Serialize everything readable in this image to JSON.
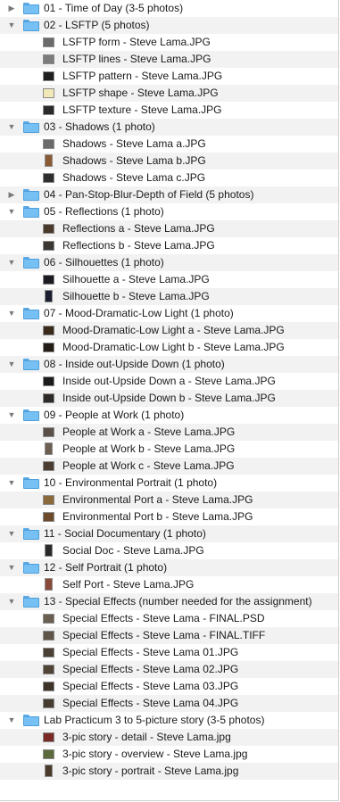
{
  "rows": [
    {
      "type": "folder",
      "expanded": false,
      "name": "01 - Time of Day (3-5 photos)"
    },
    {
      "type": "folder",
      "expanded": true,
      "name": "02 - LSFTP (5 photos)"
    },
    {
      "type": "file",
      "name": "LSFTP form - Steve Lama.JPG",
      "thumb": {
        "color": "#6a6a6a",
        "orientation": "landscape"
      }
    },
    {
      "type": "file",
      "name": "LSFTP lines - Steve Lama.JPG",
      "thumb": {
        "color": "#7c7c7c",
        "orientation": "landscape"
      }
    },
    {
      "type": "file",
      "name": "LSFTP pattern - Steve Lama.JPG",
      "thumb": {
        "color": "#1e1e1e",
        "orientation": "landscape"
      }
    },
    {
      "type": "file",
      "name": "LSFTP shape - Steve Lama.JPG",
      "thumb": {
        "color": "#f1e8b8",
        "orientation": "landscape"
      }
    },
    {
      "type": "file",
      "name": "LSFTP texture - Steve Lama.JPG",
      "thumb": {
        "color": "#2a2a2a",
        "orientation": "landscape"
      }
    },
    {
      "type": "folder",
      "expanded": true,
      "name": "03 - Shadows (1 photo)"
    },
    {
      "type": "file",
      "name": "Shadows - Steve Lama a.JPG",
      "thumb": {
        "color": "#6b6b6b",
        "orientation": "landscape"
      }
    },
    {
      "type": "file",
      "name": "Shadows - Steve Lama b.JPG",
      "thumb": {
        "color": "#8a5a34",
        "orientation": "portrait"
      }
    },
    {
      "type": "file",
      "name": "Shadows - Steve Lama c.JPG",
      "thumb": {
        "color": "#2e2e2e",
        "orientation": "landscape"
      }
    },
    {
      "type": "folder",
      "expanded": false,
      "name": "04 - Pan-Stop-Blur-Depth of Field (5 photos)"
    },
    {
      "type": "folder",
      "expanded": true,
      "name": "05 - Reflections (1 photo)"
    },
    {
      "type": "file",
      "name": "Reflections a - Steve Lama.JPG",
      "thumb": {
        "color": "#4a3a2c",
        "orientation": "landscape"
      }
    },
    {
      "type": "file",
      "name": "Reflections b - Steve Lama.JPG",
      "thumb": {
        "color": "#3a3632",
        "orientation": "landscape"
      }
    },
    {
      "type": "folder",
      "expanded": true,
      "name": "06 - Silhouettes (1 photo)"
    },
    {
      "type": "file",
      "name": "Silhouette a - Steve Lama.JPG",
      "thumb": {
        "color": "#1c1c22",
        "orientation": "landscape"
      }
    },
    {
      "type": "file",
      "name": "Silhouette b - Steve Lama.JPG",
      "thumb": {
        "color": "#1a1e30",
        "orientation": "portrait"
      }
    },
    {
      "type": "folder",
      "expanded": true,
      "name": "07 - Mood-Dramatic-Low Light (1 photo)"
    },
    {
      "type": "file",
      "name": "Mood-Dramatic-Low Light a - Steve Lama.JPG",
      "thumb": {
        "color": "#3a2a1c",
        "orientation": "landscape"
      }
    },
    {
      "type": "file",
      "name": "Mood-Dramatic-Low Light b - Steve Lama.JPG",
      "thumb": {
        "color": "#241c16",
        "orientation": "landscape"
      }
    },
    {
      "type": "folder",
      "expanded": true,
      "name": "08 - Inside out-Upside Down (1 photo)"
    },
    {
      "type": "file",
      "name": "Inside out-Upside Down a - Steve Lama.JPG",
      "thumb": {
        "color": "#1c1c1c",
        "orientation": "landscape"
      }
    },
    {
      "type": "file",
      "name": "Inside out-Upside Down b - Steve Lama.JPG",
      "thumb": {
        "color": "#2e2a28",
        "orientation": "landscape"
      }
    },
    {
      "type": "folder",
      "expanded": true,
      "name": "09 - People at Work (1 photo)"
    },
    {
      "type": "file",
      "name": "People at Work a - Steve Lama.JPG",
      "thumb": {
        "color": "#5a5048",
        "orientation": "landscape"
      }
    },
    {
      "type": "file",
      "name": "People at Work b - Steve Lama.JPG",
      "thumb": {
        "color": "#6c5e50",
        "orientation": "portrait"
      }
    },
    {
      "type": "file",
      "name": "People at Work c - Steve Lama.JPG",
      "thumb": {
        "color": "#4a3c30",
        "orientation": "landscape"
      }
    },
    {
      "type": "folder",
      "expanded": true,
      "name": "10 - Environmental Portrait (1 photo)"
    },
    {
      "type": "file",
      "name": "Environmental Port a - Steve Lama.JPG",
      "thumb": {
        "color": "#8a6a3c",
        "orientation": "landscape"
      }
    },
    {
      "type": "file",
      "name": "Environmental Port b - Steve Lama.JPG",
      "thumb": {
        "color": "#6c4a2a",
        "orientation": "landscape"
      }
    },
    {
      "type": "folder",
      "expanded": true,
      "name": "11 - Social Documentary (1 photo)"
    },
    {
      "type": "file",
      "name": "Social Doc - Steve Lama.JPG",
      "thumb": {
        "color": "#2a2a2a",
        "orientation": "portrait"
      }
    },
    {
      "type": "folder",
      "expanded": true,
      "name": "12 - Self Portrait (1 photo)"
    },
    {
      "type": "file",
      "name": "Self Port - Steve Lama.JPG",
      "thumb": {
        "color": "#8a4a3a",
        "orientation": "portrait"
      }
    },
    {
      "type": "folder",
      "expanded": true,
      "name": "13 - Special Effects (number needed for the assignment)"
    },
    {
      "type": "file",
      "name": "Special Effects - Steve Lama - FINAL.PSD",
      "thumb": {
        "color": "#6a5e52",
        "orientation": "landscape"
      }
    },
    {
      "type": "file",
      "name": "Special Effects - Steve Lama - FINAL.TIFF",
      "thumb": {
        "color": "#5e544a",
        "orientation": "landscape"
      }
    },
    {
      "type": "file",
      "name": "Special Effects - Steve Lama 01.JPG",
      "thumb": {
        "color": "#4a4034",
        "orientation": "landscape"
      }
    },
    {
      "type": "file",
      "name": "Special Effects - Steve Lama 02.JPG",
      "thumb": {
        "color": "#504436",
        "orientation": "landscape"
      }
    },
    {
      "type": "file",
      "name": "Special Effects - Steve Lama 03.JPG",
      "thumb": {
        "color": "#3e342a",
        "orientation": "landscape"
      }
    },
    {
      "type": "file",
      "name": "Special Effects - Steve Lama 04.JPG",
      "thumb": {
        "color": "#463c30",
        "orientation": "landscape"
      }
    },
    {
      "type": "folder",
      "expanded": true,
      "name": "Lab Practicum 3 to 5-picture story (3-5 photos)"
    },
    {
      "type": "file",
      "name": "3-pic story - detail - Steve Lama.jpg",
      "thumb": {
        "color": "#7a2a24",
        "orientation": "landscape"
      }
    },
    {
      "type": "file",
      "name": "3-pic story - overview - Steve Lama.jpg",
      "thumb": {
        "color": "#5a6a3a",
        "orientation": "landscape"
      }
    },
    {
      "type": "file",
      "name": "3-pic story - portrait - Steve Lama.jpg",
      "thumb": {
        "color": "#4a3a2a",
        "orientation": "portrait"
      }
    }
  ],
  "colors": {
    "row_alt": "#f2f2f2",
    "folder": "#77c0f3",
    "disclosure": "#7a7a7a"
  }
}
